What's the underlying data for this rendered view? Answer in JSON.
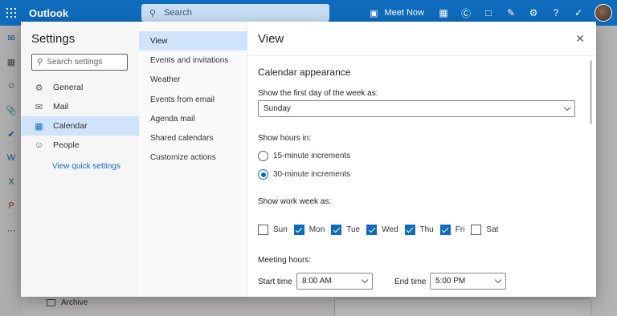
{
  "app": {
    "title": "Outlook"
  },
  "search": {
    "placeholder": "Search"
  },
  "topbar": {
    "meet_now": "Meet Now"
  },
  "background": {
    "archive_label": "Archive"
  },
  "settings": {
    "title": "Settings",
    "search_placeholder": "Search settings",
    "categories": [
      {
        "label": "General",
        "icon": "gear-icon"
      },
      {
        "label": "Mail",
        "icon": "mail-icon"
      },
      {
        "label": "Calendar",
        "icon": "calendar-icon",
        "selected": true
      },
      {
        "label": "People",
        "icon": "people-icon"
      }
    ],
    "quick_settings_link": "View quick settings",
    "subcategories": [
      {
        "label": "View",
        "selected": true
      },
      {
        "label": "Events and invitations"
      },
      {
        "label": "Weather"
      },
      {
        "label": "Events from email"
      },
      {
        "label": "Agenda mail"
      },
      {
        "label": "Shared calendars"
      },
      {
        "label": "Customize actions"
      }
    ]
  },
  "pane": {
    "title": "View",
    "section_heading": "Calendar appearance",
    "first_day_label": "Show the first day of the week as:",
    "first_day_value": "Sunday",
    "hours_label": "Show hours in:",
    "hours_options": [
      {
        "label": "15-minute increments",
        "selected": false
      },
      {
        "label": "30-minute increments",
        "selected": true
      }
    ],
    "work_week_label": "Show work week as:",
    "work_week_days": [
      {
        "label": "Sun",
        "checked": false
      },
      {
        "label": "Mon",
        "checked": true
      },
      {
        "label": "Tue",
        "checked": true
      },
      {
        "label": "Wed",
        "checked": true
      },
      {
        "label": "Thu",
        "checked": true
      },
      {
        "label": "Fri",
        "checked": true
      },
      {
        "label": "Sat",
        "checked": false
      }
    ],
    "meeting_hours_label": "Meeting hours:",
    "start_time_label": "Start time",
    "start_time_value": "8:00 AM",
    "end_time_label": "End time",
    "end_time_value": "5:00 PM"
  }
}
